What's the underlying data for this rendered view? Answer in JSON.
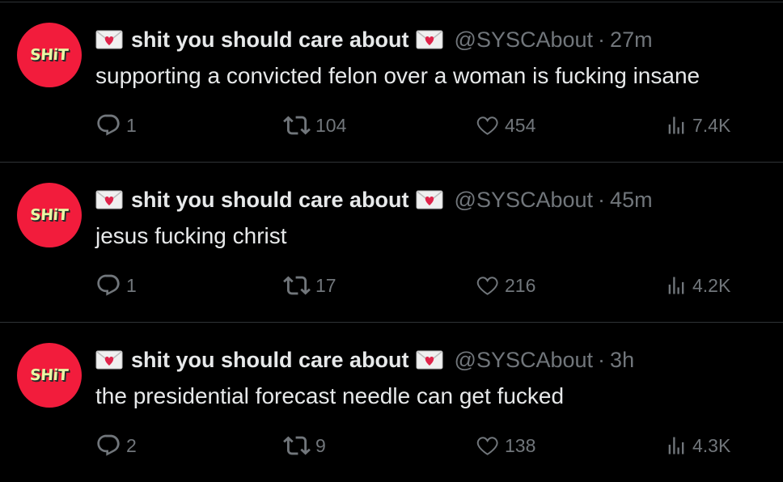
{
  "tweets": [
    {
      "avatar_text": "SHiT",
      "display_name": "shit you should care about",
      "handle": "@SYSCAbout",
      "separator": "·",
      "time": "27m",
      "text": "supporting a convicted felon over a woman is fucking insane",
      "replies": "1",
      "retweets": "104",
      "likes": "454",
      "views": "7.4K"
    },
    {
      "avatar_text": "SHiT",
      "display_name": "shit you should care about",
      "handle": "@SYSCAbout",
      "separator": "·",
      "time": "45m",
      "text": "jesus fucking christ",
      "replies": "1",
      "retweets": "17",
      "likes": "216",
      "views": "4.2K"
    },
    {
      "avatar_text": "SHiT",
      "display_name": "shit you should care about",
      "handle": "@SYSCAbout",
      "separator": "·",
      "time": "3h",
      "text": "the presidential forecast needle can get fucked",
      "replies": "2",
      "retweets": "9",
      "likes": "138",
      "views": "4.3K"
    }
  ],
  "icons": {
    "name_emoji": "love-letter-icon",
    "reply": "reply-bubble-icon",
    "retweet": "retweet-icon",
    "like": "heart-icon",
    "views": "views-bar-chart-icon"
  },
  "colors": {
    "background": "#000000",
    "text_primary": "#e7e9ea",
    "text_secondary": "#71767b",
    "divider": "#2f3336",
    "avatar_bg": "#f21c3c",
    "avatar_text": "#e8f7a4"
  }
}
